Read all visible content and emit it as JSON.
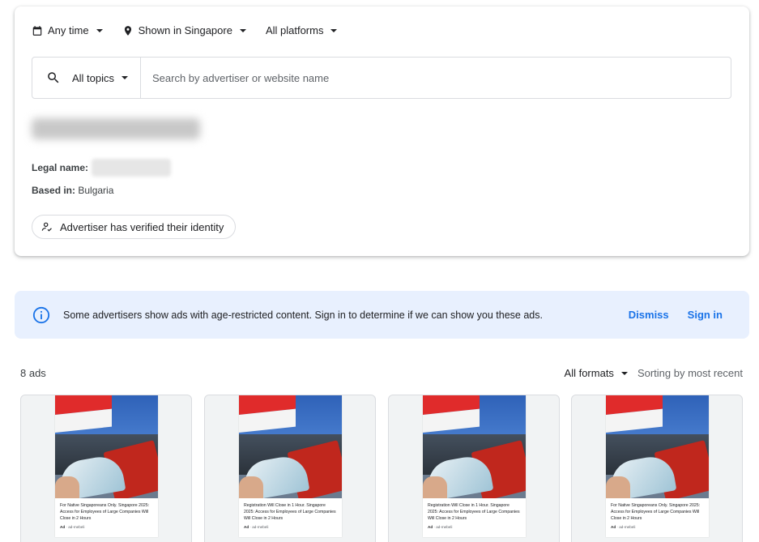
{
  "filters": {
    "time": "Any time",
    "location": "Shown in Singapore",
    "platforms": "All platforms"
  },
  "search": {
    "topics": "All topics",
    "placeholder": "Search by advertiser or website name"
  },
  "advertiser": {
    "legal_label": "Legal name:",
    "based_label": "Based in:",
    "based_value": " Bulgaria",
    "verified": "Advertiser has verified their identity"
  },
  "banner": {
    "message": "Some advertisers show ads with age-restricted content. Sign in to determine if we can show you these ads.",
    "dismiss": "Dismiss",
    "signin": "Sign in"
  },
  "results": {
    "count": "8 ads",
    "formats": "All formats",
    "sort": "Sorting by most recent"
  },
  "ads": [
    {
      "text": "For Native Singaporeans Only. Singapore 2025: Access for Employees of Large Companies Will Close in 2 Hours",
      "ad_label": "Ad",
      "domain": "ad-mebeli"
    },
    {
      "text": "Registration Will Close in 1 Hour. Singapore 2025: Access for Employees of Large Companies Will Close in 2 Hours",
      "ad_label": "Ad",
      "domain": "ad-mebeli"
    },
    {
      "text": "Registration Will Close in 1 Hour. Singapore 2025: Access for Employees of Large Companies Will Close in 2 Hours",
      "ad_label": "Ad",
      "domain": "ad-mebeli"
    },
    {
      "text": "For Native Singaporeans Only. Singapore 2025: Access for Employees of Large Companies Will Close in 2 Hours",
      "ad_label": "Ad",
      "domain": "ad-mebeli"
    }
  ],
  "colors": {
    "accent": "#1a73e8",
    "banner_bg": "#e8f0fe"
  }
}
